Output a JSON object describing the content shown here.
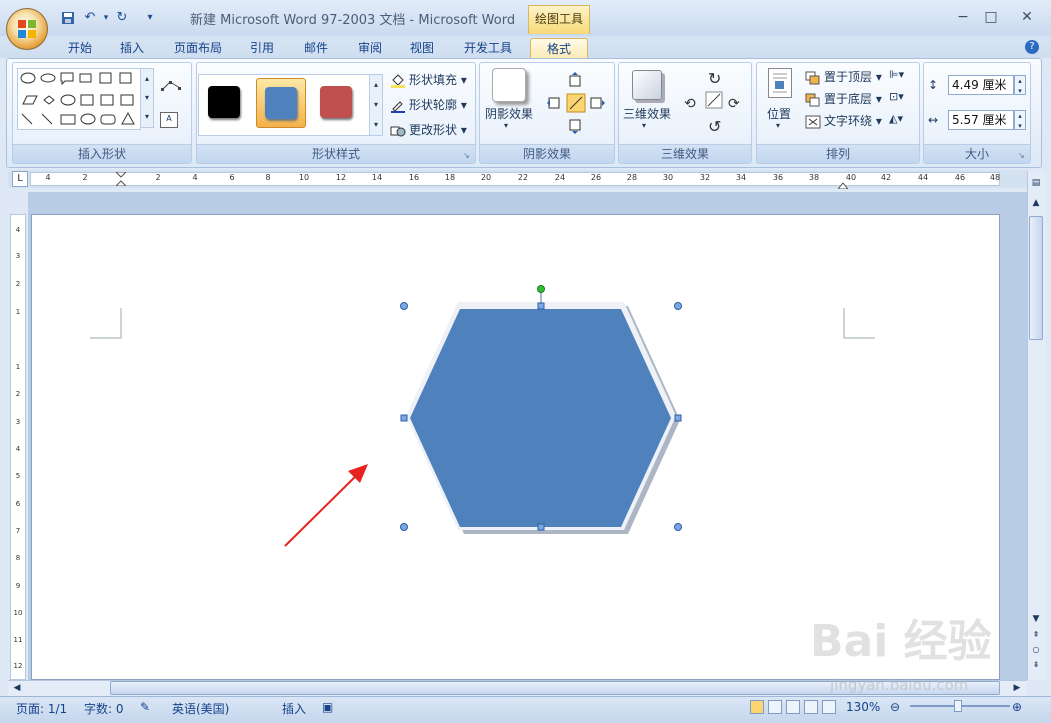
{
  "window": {
    "title": "新建 Microsoft Word 97-2003 文档 - Microsoft Word",
    "context_tab_title": "绘图工具",
    "controls": {
      "minimize": "−",
      "maximize": "□",
      "close": "✕"
    }
  },
  "quick_access": {
    "save_icon": "save-icon",
    "undo_icon": "undo-icon",
    "redo_icon": "redo-icon",
    "customize_icon": "customize-icon"
  },
  "tabs": [
    "开始",
    "插入",
    "页面布局",
    "引用",
    "邮件",
    "审阅",
    "视图",
    "开发工具",
    "格式"
  ],
  "active_tab": "格式",
  "help": "?",
  "ribbon": {
    "insert_shapes": {
      "label": "插入形状"
    },
    "shape_styles": {
      "label": "形状样式",
      "swatches": [
        "#000000",
        "#4f81bd",
        "#c0504d"
      ],
      "fill": "形状填充",
      "outline": "形状轮廓",
      "change_shape": "更改形状"
    },
    "shadow_effects": {
      "label": "阴影效果",
      "button": "阴影效果"
    },
    "threed_effects": {
      "label": "三维效果",
      "button": "三维效果"
    },
    "arrange": {
      "label": "排列",
      "position": "位置",
      "bring_front": "置于顶层",
      "send_back": "置于底层",
      "text_wrap": "文字环绕"
    },
    "size": {
      "label": "大小",
      "height": "4.49 厘米",
      "width": "5.57 厘米"
    }
  },
  "ruler": {
    "corner": "L",
    "numbers": [
      "4",
      "2",
      "2",
      "4",
      "6",
      "8",
      "10",
      "12",
      "14",
      "16",
      "18",
      "20",
      "22",
      "24",
      "26",
      "28",
      "30",
      "32",
      "34",
      "36",
      "38",
      "40",
      "42",
      "44",
      "46",
      "48"
    ],
    "vertical": [
      "4",
      "3",
      "2",
      "1",
      "1",
      "1",
      "2",
      "3",
      "4",
      "5",
      "6",
      "7",
      "8",
      "9",
      "10",
      "11",
      "12"
    ]
  },
  "document": {
    "shape_fill": "#4f81bd",
    "shape": "hexagon"
  },
  "status": {
    "page": "页面: 1/1",
    "words": "字数: 0",
    "language": "英语(美国)",
    "mode": "插入",
    "zoom": "130%"
  },
  "watermark": {
    "text": "Bai 经验",
    "url": "jingyan.baidu.com"
  }
}
